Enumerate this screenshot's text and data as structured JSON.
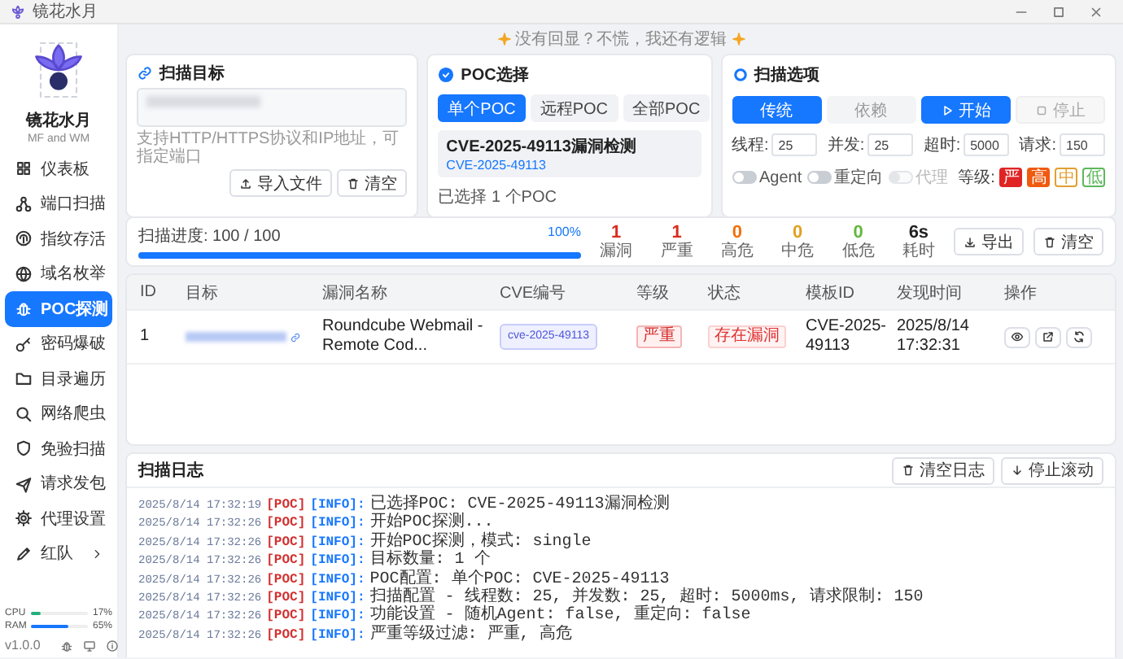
{
  "window": {
    "title": "镜花水月"
  },
  "header": {
    "slogan": "没有回显？不慌，我还有逻辑"
  },
  "sidebar": {
    "app_name": "镜花水月",
    "subtitle": "MF and WM",
    "items": [
      {
        "label": "仪表板",
        "selected": false
      },
      {
        "label": "端口扫描",
        "selected": false
      },
      {
        "label": "指纹存活",
        "selected": false
      },
      {
        "label": "域名枚举",
        "selected": false
      },
      {
        "label": "POC探测",
        "selected": true
      },
      {
        "label": "密码爆破",
        "selected": false
      },
      {
        "label": "目录遍历",
        "selected": false
      },
      {
        "label": "网络爬虫",
        "selected": false
      },
      {
        "label": "免验扫描",
        "selected": false
      },
      {
        "label": "请求发包",
        "selected": false
      },
      {
        "label": "代理设置",
        "selected": false
      },
      {
        "label": "红队",
        "selected": false,
        "expandable": true
      }
    ],
    "meters": [
      {
        "name": "CPU",
        "level": 0.17,
        "reading": "17%",
        "color": "#22b07d"
      },
      {
        "name": "RAM",
        "level": 0.65,
        "reading": "65%",
        "color": "#1677ff"
      }
    ],
    "version": "v1.0.0"
  },
  "scan_target": {
    "title": "扫描目标",
    "hint": "支持HTTP/HTTPS协议和IP地址，可指定端口",
    "buttons": [
      "导入文件",
      "清空"
    ]
  },
  "poc": {
    "title": "POC选择",
    "modes": [
      {
        "label": "单个POC",
        "selected": true
      },
      {
        "label": "远程POC",
        "selected": false
      },
      {
        "label": "全部POC",
        "selected": false
      }
    ],
    "selected_poc": {
      "name": "CVE-2025-49113漏洞检测",
      "id": "CVE-2025-49113"
    },
    "summary": "已选择 1 个POC"
  },
  "options": {
    "title": "扫描选项",
    "modes": [
      {
        "label": "传统",
        "selected": true
      },
      {
        "label": "依赖",
        "selected": false
      }
    ],
    "start": "开始",
    "stop": {
      "label": "停止",
      "disabled": true
    },
    "fields": [
      {
        "label": "线程:",
        "value": "25"
      },
      {
        "label": "并发:",
        "value": "25"
      },
      {
        "label": "超时:",
        "value": "5000"
      },
      {
        "label": "请求:",
        "value": "150"
      }
    ],
    "toggles": [
      {
        "label": "Agent",
        "on": false,
        "disabled": false
      },
      {
        "label": "重定向",
        "on": false,
        "disabled": false
      },
      {
        "label": "代理",
        "on": false,
        "disabled": true
      }
    ],
    "level_label": "等级:",
    "levels": [
      {
        "label": "严",
        "selected": true,
        "color": "#e02424"
      },
      {
        "label": "高",
        "selected": true,
        "color": "#f05a0e"
      },
      {
        "label": "中",
        "selected": false,
        "color": "#e0a030"
      },
      {
        "label": "低",
        "selected": false,
        "color": "#5cb85c"
      }
    ]
  },
  "progress": {
    "label": "扫描进度: 100 / 100",
    "percent": "100%",
    "level": 1,
    "stats": [
      {
        "value": "1",
        "label": "漏洞",
        "color": "#d92d20"
      },
      {
        "value": "1",
        "label": "严重",
        "color": "#d92d20"
      },
      {
        "value": "0",
        "label": "高危",
        "color": "#f0700c"
      },
      {
        "value": "0",
        "label": "中危",
        "color": "#e0a020"
      },
      {
        "value": "0",
        "label": "低危",
        "color": "#62b83c"
      },
      {
        "value": "6s",
        "label": "耗时",
        "color": "#222222"
      }
    ],
    "buttons": [
      "导出",
      "清空"
    ]
  },
  "table": {
    "columns": [
      "ID",
      "目标",
      "漏洞名称",
      "CVE编号",
      "等级",
      "状态",
      "模板ID",
      "发现时间",
      "操作"
    ],
    "rows": [
      {
        "id": "1",
        "name": "Roundcube Webmail - Remote Cod...",
        "cve": "cve-2025-49113",
        "severity": "严重",
        "status": "存在漏洞",
        "template_id": "CVE-2025-49113",
        "time": "2025/8/14 17:32:31"
      }
    ]
  },
  "log": {
    "title": "扫描日志",
    "buttons": [
      "清空日志",
      "停止滚动"
    ],
    "entries": [
      {
        "time": "2025/8/14 17:32:19",
        "module": "[POC]",
        "level": "[INFO]:",
        "message": "已选择POC: CVE-2025-49113漏洞检测"
      },
      {
        "time": "2025/8/14 17:32:26",
        "module": "[POC]",
        "level": "[INFO]:",
        "message": "开始POC探测..."
      },
      {
        "time": "2025/8/14 17:32:26",
        "module": "[POC]",
        "level": "[INFO]:",
        "message": "开始POC探测，模式: single"
      },
      {
        "time": "2025/8/14 17:32:26",
        "module": "[POC]",
        "level": "[INFO]:",
        "message": "目标数量: 1 个"
      },
      {
        "time": "2025/8/14 17:32:26",
        "module": "[POC]",
        "level": "[INFO]:",
        "message": "POC配置: 单个POC: CVE-2025-49113"
      },
      {
        "time": "2025/8/14 17:32:26",
        "module": "[POC]",
        "level": "[INFO]:",
        "message": "扫描配置 - 线程数: 25, 并发数: 25, 超时: 5000ms, 请求限制: 150"
      },
      {
        "time": "2025/8/14 17:32:26",
        "module": "[POC]",
        "level": "[INFO]:",
        "message": "功能设置 - 随机Agent: false, 重定向: false"
      },
      {
        "time": "2025/8/14 17:32:26",
        "module": "[POC]",
        "level": "[INFO]:",
        "message": "严重等级过滤: 严重, 高危"
      }
    ]
  }
}
